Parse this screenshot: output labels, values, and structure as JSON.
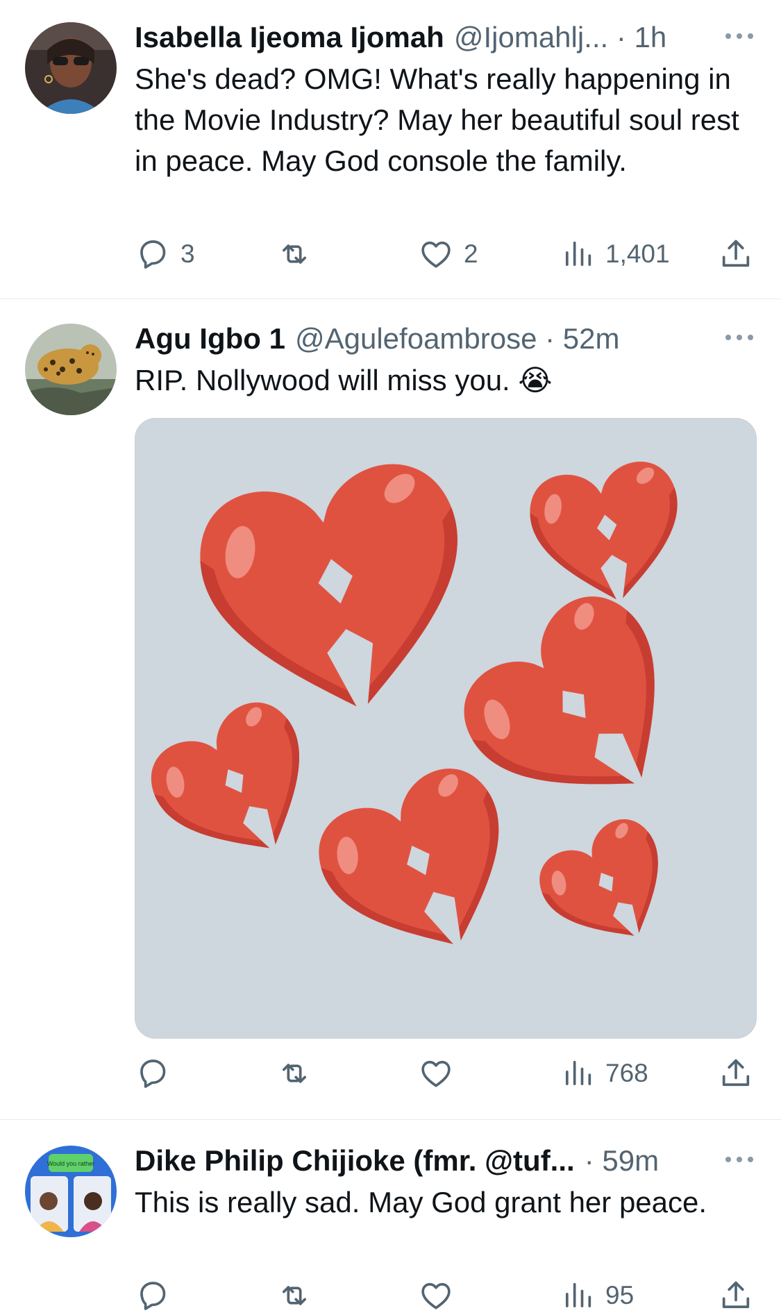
{
  "tweets": [
    {
      "name": "Isabella Ijeoma Ijomah",
      "handle_time": "@Ijomahlj... · 1h",
      "text": "She's dead? OMG! What's really happening in the Movie Industry? May her beautiful soul rest in peace. May God console the family.",
      "replies": "3",
      "likes": "2",
      "views": "1,401"
    },
    {
      "name": "Agu Igbo 1",
      "handle_time": "@Agulefoambrose · 52m",
      "text": "RIP. Nollywood will miss you. 😭",
      "views": "768"
    },
    {
      "name": "Dike Philip Chijioke (fmr. @tuf...",
      "handle_time": "· 59m",
      "text": "This is really sad. May God grant her peace.",
      "views": "95"
    }
  ],
  "avatar_3_text": "Would you rather",
  "icons": [
    "reply-icon",
    "retweet-icon",
    "like-icon",
    "views-icon",
    "share-icon",
    "more-icon",
    "broken-heart-icon"
  ],
  "colors": {
    "text": "#0f1419",
    "secondary": "#536471",
    "heart": "#e05240",
    "heart_dark": "#c73d31",
    "media_bg": "#ced6de"
  }
}
